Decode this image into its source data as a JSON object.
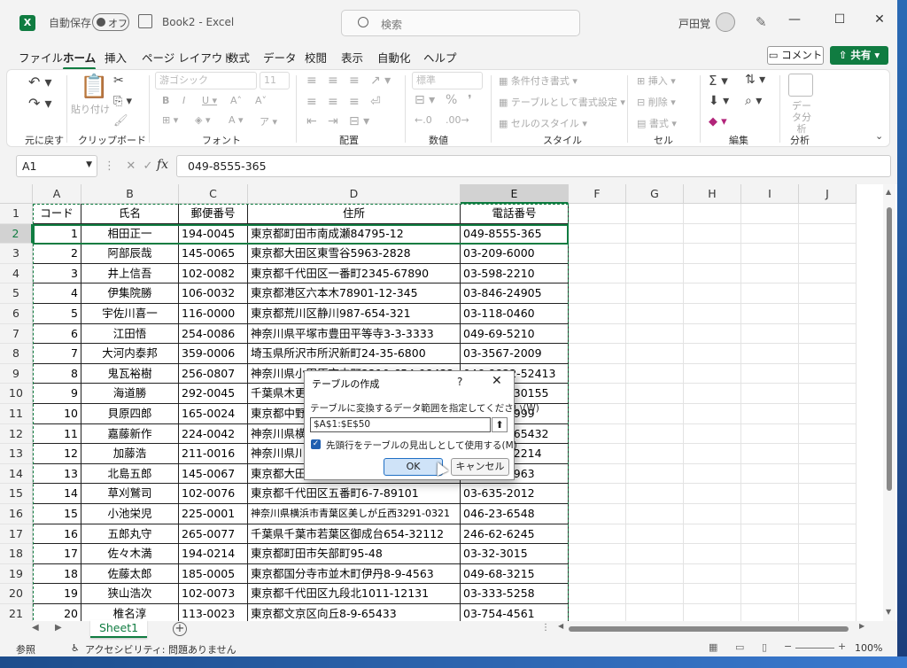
{
  "titlebar": {
    "autosave_label": "自動保存",
    "toggle_state": "オフ",
    "window_title": "Book2  -  Excel",
    "search_placeholder": "検索",
    "user_name": "戸田覚"
  },
  "menu": [
    "ファイル",
    "ホーム",
    "挿入",
    "ページ レイアウト",
    "数式",
    "データ",
    "校閲",
    "表示",
    "自動化",
    "ヘルプ"
  ],
  "menu_active": "ホーム",
  "comment_label": "コメント",
  "share_label": "共有",
  "ribbon": {
    "groups": [
      "元に戻す",
      "クリップボード",
      "フォント",
      "配置",
      "数値",
      "スタイル",
      "セル",
      "編集",
      "分析"
    ],
    "paste_label": "貼り付け",
    "font_name": "游ゴシック",
    "font_size": "11",
    "number_format": "標準",
    "conditional_format": "条件付き書式",
    "format_as_table": "テーブルとして書式設定",
    "cell_styles": "セルのスタイル",
    "insert": "挿入",
    "delete": "削除",
    "format": "書式",
    "data_analysis": "データ分析"
  },
  "formula_bar": {
    "name_box": "A1",
    "formula": "049-8555-365"
  },
  "columns": [
    "A",
    "B",
    "C",
    "D",
    "E",
    "F",
    "G",
    "H",
    "I",
    "J"
  ],
  "headers": [
    "コード",
    "氏名",
    "郵便番号",
    "住所",
    "電話番号"
  ],
  "rows": [
    [
      "1",
      "相田正一",
      "194-0045",
      "東京都町田市南成瀬84795-12",
      "049-8555-365"
    ],
    [
      "2",
      "阿部辰哉",
      "145-0065",
      "東京都大田区東雪谷5963-2828",
      "03-209-6000"
    ],
    [
      "3",
      "井上信吾",
      "102-0082",
      "東京都千代田区一番町2345-67890",
      "03-598-2210"
    ],
    [
      "4",
      "伊集院勝",
      "106-0032",
      "東京都港区六本木78901-12-345",
      "03-846-24905"
    ],
    [
      "5",
      "宇佐川喜一",
      "116-0000",
      "東京都荒川区静川987-654-321",
      "03-118-0460"
    ],
    [
      "6",
      "江田悟",
      "254-0086",
      "神奈川県平塚市豊田平等寺3-3-3333",
      "049-69-5210"
    ],
    [
      "7",
      "大河内泰邦",
      "359-0006",
      "埼玉県所沢市所沢新町24-35-6800",
      "03-3567-2009"
    ],
    [
      "8",
      "鬼瓦裕樹",
      "256-0807",
      "神奈川県小田原市中町3210-654-98432",
      "046-8832-52413"
    ],
    [
      "9",
      "海道勝",
      "292-0045",
      "千葉県木更津市清見台東4-5-30155",
      "043-555-30155"
    ],
    [
      "10",
      "貝原四郎",
      "165-0024",
      "東京都中野区松が丘2-2-999",
      "03-555-0999"
    ],
    [
      "11",
      "嘉藤新作",
      "224-0042",
      "神奈川県横浜市都筑区大熊町65432",
      "045-345-65432"
    ],
    [
      "12",
      "加藤浩",
      "211-0016",
      "神奈川県川崎市中原区市ノ坪2214",
      "044-555-2214"
    ],
    [
      "13",
      "北島五郎",
      "145-0067",
      "東京都大田区雪谷大塚町1963",
      "03-766-1963"
    ],
    [
      "14",
      "草刈鷲司",
      "102-0076",
      "東京都千代田区五番町6-7-89101",
      "03-635-2012"
    ],
    [
      "15",
      "小池栄児",
      "225-0001",
      "神奈川県横浜市青葉区美しが丘西3291-0321",
      "046-23-6548"
    ],
    [
      "16",
      "五郎丸守",
      "265-0077",
      "千葉県千葉市若葉区御成台654-32112",
      "246-62-6245"
    ],
    [
      "17",
      "佐々木満",
      "194-0214",
      "東京都町田市矢部町95-48",
      "03-32-3015"
    ],
    [
      "18",
      "佐藤太郎",
      "185-0005",
      "東京都国分寺市並木町伊丹8-9-4563",
      "049-68-3215"
    ],
    [
      "19",
      "狭山浩次",
      "102-0073",
      "東京都千代田区九段北1011-12131",
      "03-333-5258"
    ],
    [
      "20",
      "椎名淳",
      "113-0023",
      "東京都文京区向丘8-9-65433",
      "03-754-4561"
    ]
  ],
  "sheet_tab": "Sheet1",
  "status": {
    "mode": "参照",
    "accessibility": "アクセシビリティ: 問題ありません",
    "zoom": "100%"
  },
  "dialog": {
    "title": "テーブルの作成",
    "help": "?",
    "close": "✕",
    "prompt": "テーブルに変換するデータ範囲を指定してください(W)",
    "range": "$A$1:$E$50",
    "checkbox_label": "先頭行をテーブルの見出しとして使用する(M)",
    "ok": "OK",
    "cancel": "キャンセル"
  }
}
